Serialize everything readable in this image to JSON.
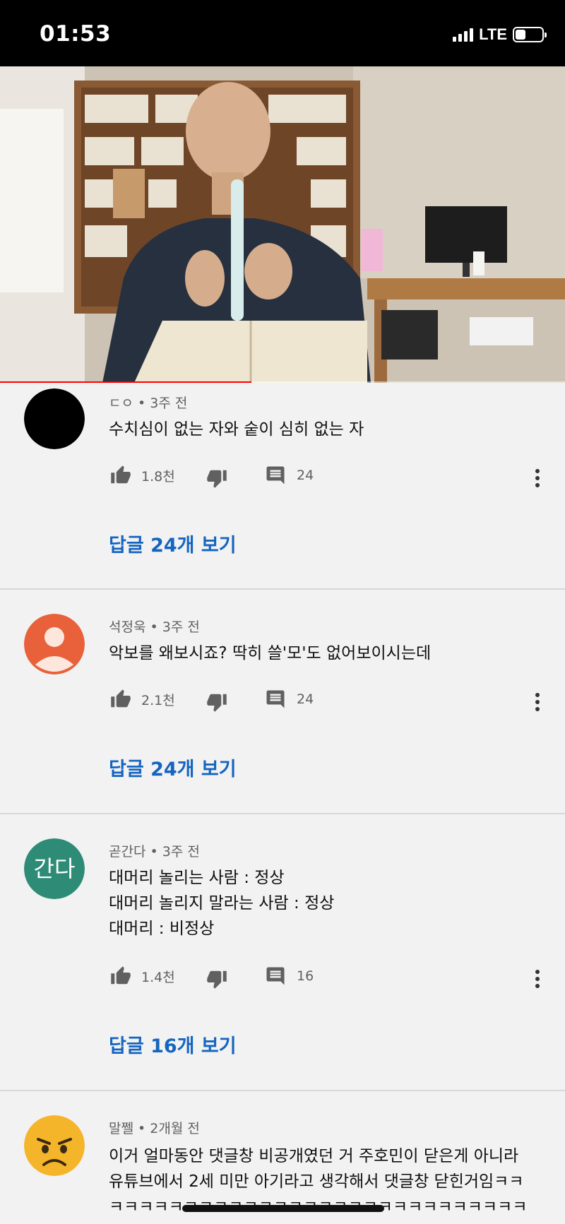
{
  "status_bar": {
    "time": "01:53",
    "network": "LTE"
  },
  "video": {
    "progress_fraction": 0.445,
    "accent": "#ff0000"
  },
  "comments": [
    {
      "author": "ㄷㅇ",
      "age": "3주 전",
      "text": "수치심이 없는 자와 숱이 심히 없는 자",
      "likes": "1.8천",
      "replies": "24",
      "view_replies": "답글 24개 보기",
      "avatar": {
        "kind": "solid",
        "color": "#000000"
      }
    },
    {
      "author": "석정욱",
      "age": "3주 전",
      "text": "악보를 왜보시죠? 딱히 쓸'모'도 없어보이시는데",
      "likes": "2.1천",
      "replies": "24",
      "view_replies": "답글 24개 보기",
      "avatar": {
        "kind": "person",
        "color": "#e8613a"
      }
    },
    {
      "author": "곧간다",
      "age": "3주 전",
      "text": "대머리 놀리는 사람 : 정상\n대머리 놀리지 말라는 사람 : 정상\n대머리 : 비정상",
      "likes": "1.4천",
      "replies": "16",
      "view_replies": "답글 16개 보기",
      "avatar": {
        "kind": "text",
        "label": "간다",
        "color": "#2e8c76"
      }
    },
    {
      "author": "말쩰",
      "age": "2개월 전",
      "text": "이거 얼마동안 댓글창 비공개였던 거 주호민이 닫은게 아니라\n유튜브에서 2세 미만 아기라고 생각해서 댓글창 닫힌거임ㅋㅋ\nㅋㅋㅋㅋㅋㅋㅋㅋㅋㅋㅋㅋㅋㅋㅋㅋㅋㅋㅋㅋㅋㅋㅋㅋㅋㅋㅋㅋ",
      "avatar": {
        "kind": "emoji",
        "icon": "angry-face-icon",
        "color": "#f5b52a"
      }
    }
  ]
}
